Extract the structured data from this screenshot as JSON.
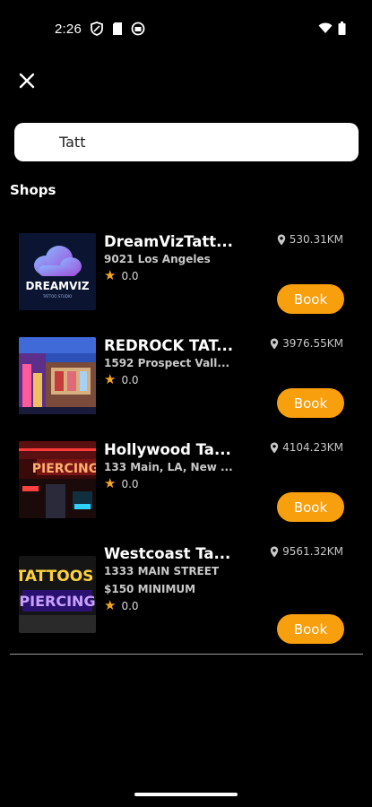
{
  "status_bar": {
    "time": "2:26"
  },
  "search": {
    "value": "Tatt",
    "placeholder": ""
  },
  "section": {
    "title": "Shops"
  },
  "shops": [
    {
      "name": "DreamVizTatt...",
      "address": "9021 Los Angeles",
      "address2": "",
      "rating": "0.0",
      "distance": "530.31KM",
      "book_label": "Book",
      "logo": {
        "text": "DREAMVIZ",
        "subtext": "TATTOO STUDIO"
      }
    },
    {
      "name": "REDROCK TAT...",
      "address": "1592 Prospect Vall...",
      "address2": "",
      "rating": "0.0",
      "distance": "3976.55KM",
      "book_label": "Book"
    },
    {
      "name": "Hollywood Ta...",
      "address": "133 Main, LA, New ...",
      "address2": "",
      "rating": "0.0",
      "distance": "4104.23KM",
      "book_label": "Book",
      "sign": {
        "text": "PIERCING"
      }
    },
    {
      "name": "Westcoast Ta...",
      "address": "1333 MAIN STREET",
      "address2": "$150 MINIMUM",
      "rating": "0.0",
      "distance": "9561.32KM",
      "book_label": "Book",
      "sign": {
        "line1": "TATTOOS",
        "line2": "PIERCING"
      }
    }
  ],
  "colors": {
    "accent": "#f79f0c",
    "background": "#000000",
    "star": "#f5a623"
  }
}
